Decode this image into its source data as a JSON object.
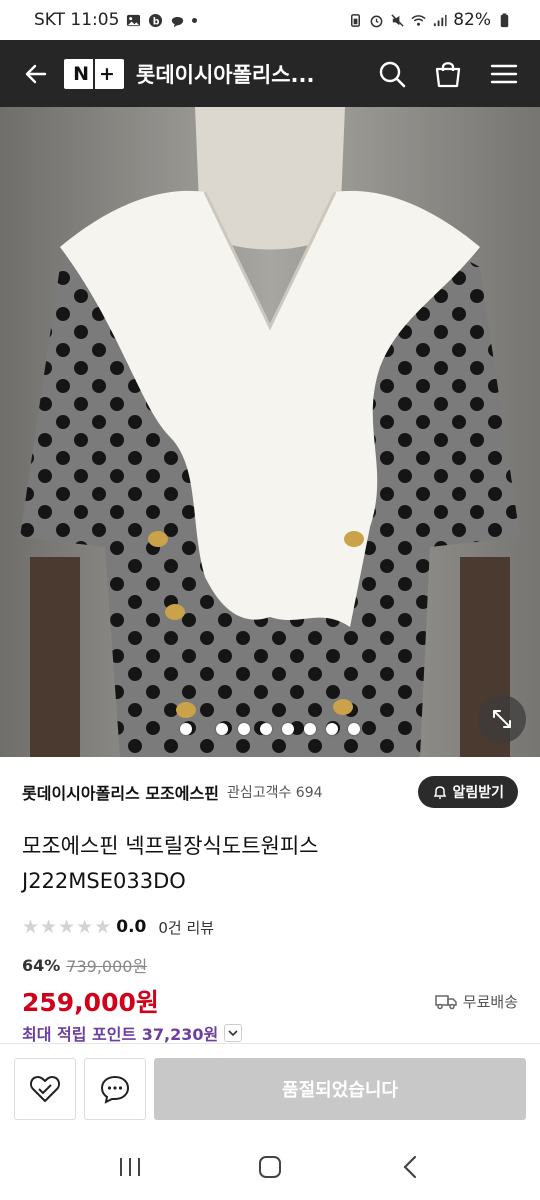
{
  "status_bar": {
    "carrier_time": "SKT 11:05",
    "battery": "82%"
  },
  "header": {
    "logo_text_left": "N",
    "logo_text_right": "+",
    "title": "롯데이시아폴리스..."
  },
  "carousel": {
    "total_dots": 8,
    "active_index": 0
  },
  "store": {
    "name": "롯데이시아폴리스 모조에스핀",
    "favorite_label": "관심고객수 694",
    "alarm_label": "알림받기"
  },
  "product": {
    "name_line1": "모조에스핀 넥프릴장식도트원피스",
    "name_line2": "J222MSE033DO",
    "rating_value": "0.0",
    "rating_stars": 5,
    "review_count": "0건 리뷰",
    "discount_rate": "64%",
    "original_price": "739,000원",
    "price": "259,000원",
    "shipping": "무료배송",
    "points": "최대 적립 포인트 37,230원"
  },
  "actions": {
    "soldout_label": "품절되었습니다"
  },
  "colors": {
    "header_bg": "#262626",
    "price_red": "#d0021b",
    "points_purple": "#6b3fa0",
    "soldout_gray": "#c8c8c8"
  }
}
